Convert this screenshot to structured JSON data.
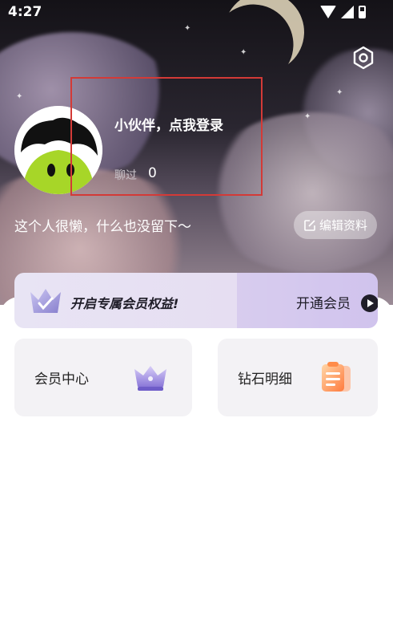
{
  "status_bar": {
    "time": "4:27"
  },
  "profile": {
    "login_prompt": "小伙伴，点我登录",
    "chat_label": "聊过",
    "chat_count": "0",
    "bio": "这个人很懒，什么也没留下～",
    "edit_label": "编辑资料"
  },
  "vip_banner": {
    "promo": "开启专属会员权益!",
    "cta": "开通会员"
  },
  "cards": [
    {
      "label": "会员中心",
      "icon": "crown-icon"
    },
    {
      "label": "钻石明细",
      "icon": "clipboard-icon"
    }
  ],
  "colors": {
    "highlight_box": "#d33a37",
    "avatar_face": "#a7d628",
    "card_bg": "#f3f2f5"
  }
}
